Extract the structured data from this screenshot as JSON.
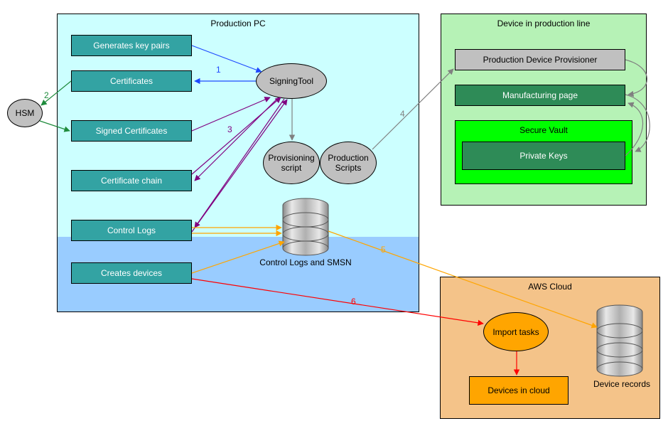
{
  "productionPc": {
    "title": "Production PC",
    "genKeyPairs": "Generates key pairs",
    "certificates": "Certificates",
    "signedCerts": "Signed Certificates",
    "certChain": "Certificate chain",
    "controlLogs": "Control Logs",
    "createsDevices": "Creates devices",
    "signingTool": "SigningTool",
    "provisioningScript": "Provisioning script",
    "productionScripts": "Production Scripts",
    "controlLogsSmsn": "Control Logs and SMSN"
  },
  "hsm": "HSM",
  "device": {
    "title": "Device in production line",
    "provisioner": "Production Device Provisioner",
    "manufacturingPage": "Manufacturing page",
    "secureVault": "Secure Vault",
    "privateKeys": "Private Keys"
  },
  "aws": {
    "title": "AWS Cloud",
    "importTasks": "Import tasks",
    "devicesInCloud": "Devices in cloud",
    "deviceRecords": "Device records"
  },
  "edges": {
    "e1": "1",
    "e2": "2",
    "e3": "3",
    "e4": "4",
    "e5": "5",
    "e6": "6"
  }
}
